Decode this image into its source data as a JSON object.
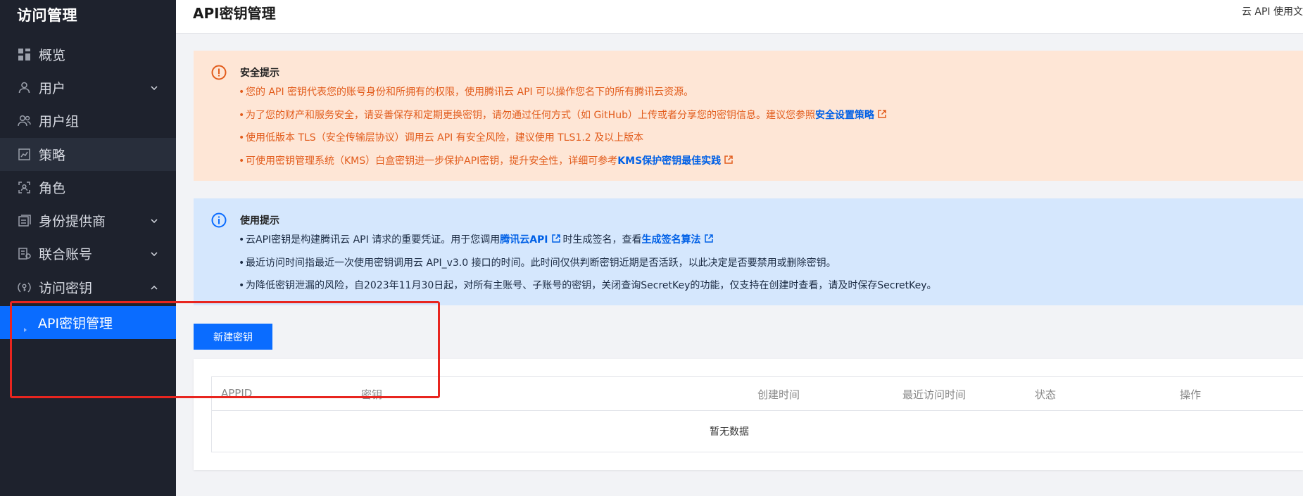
{
  "sidebar": {
    "title": "访问管理",
    "items": [
      {
        "label": "概览",
        "icon": "grid-icon",
        "chevron": false
      },
      {
        "label": "用户",
        "icon": "user-icon",
        "chevron": true
      },
      {
        "label": "用户组",
        "icon": "user-group-icon",
        "chevron": false
      },
      {
        "label": "策略",
        "icon": "policy-icon",
        "chevron": false
      },
      {
        "label": "角色",
        "icon": "role-icon",
        "chevron": false
      },
      {
        "label": "身份提供商",
        "icon": "identity-provider-icon",
        "chevron": true
      },
      {
        "label": "联合账号",
        "icon": "federated-account-icon",
        "chevron": true
      },
      {
        "label": "访问密钥",
        "icon": "access-key-icon",
        "chevron": true
      }
    ],
    "sub_item": {
      "label": "API密钥管理"
    }
  },
  "header": {
    "title": "API密钥管理",
    "right_link": "云 API 使用文"
  },
  "alert_security": {
    "title": "安全提示",
    "items": [
      {
        "text": "您的 API 密钥代表您的账号身份和所拥有的权限，使用腾讯云 API 可以操作您名下的所有腾讯云资源。",
        "link": ""
      },
      {
        "text": "为了您的财产和服务安全，请妥善保存和定期更换密钥，请勿通过任何方式（如 GitHub）上传或者分享您的密钥信息。建议您参照",
        "link": "安全设置策略"
      },
      {
        "text": "使用低版本 TLS（安全传输层协议）调用云 API 有安全风险，建议使用 TLS1.2 及以上版本",
        "link": ""
      },
      {
        "text": "可使用密钥管理系统（KMS）白盒密钥进一步保护API密钥，提升安全性，详细可参考",
        "link": "KMS保护密钥最佳实践"
      }
    ]
  },
  "alert_usage": {
    "title": "使用提示",
    "item1": {
      "pre": "云API密钥是构建腾讯云 API 请求的重要凭证。用于您调用",
      "link1": "腾讯云API",
      "mid": "时生成签名，查看",
      "link2": "生成签名算法"
    },
    "item2": "最近访问时间指最近一次使用密钥调用云 API_v3.0 接口的时间。此时间仅供判断密钥近期是否活跃，以此决定是否要禁用或删除密钥。",
    "item3": "为降低密钥泄漏的风险，自2023年11月30日起，对所有主账号、子账号的密钥，关闭查询SecretKey的功能，仅支持在创建时查看，请及时保存SecretKey。"
  },
  "toolbar": {
    "new_key_label": "新建密钥"
  },
  "table": {
    "columns": [
      "APPID",
      "密钥",
      "创建时间",
      "最近访问时间",
      "状态",
      "操作"
    ],
    "empty_text": "暂无数据"
  },
  "colors": {
    "sidebar_bg": "#1e222d",
    "accent": "#0a6cff",
    "warn_bg": "#fee6d6",
    "warn_text": "#e25c1c",
    "info_bg": "#d5e7fd",
    "annotation_red": "#e8251f"
  }
}
